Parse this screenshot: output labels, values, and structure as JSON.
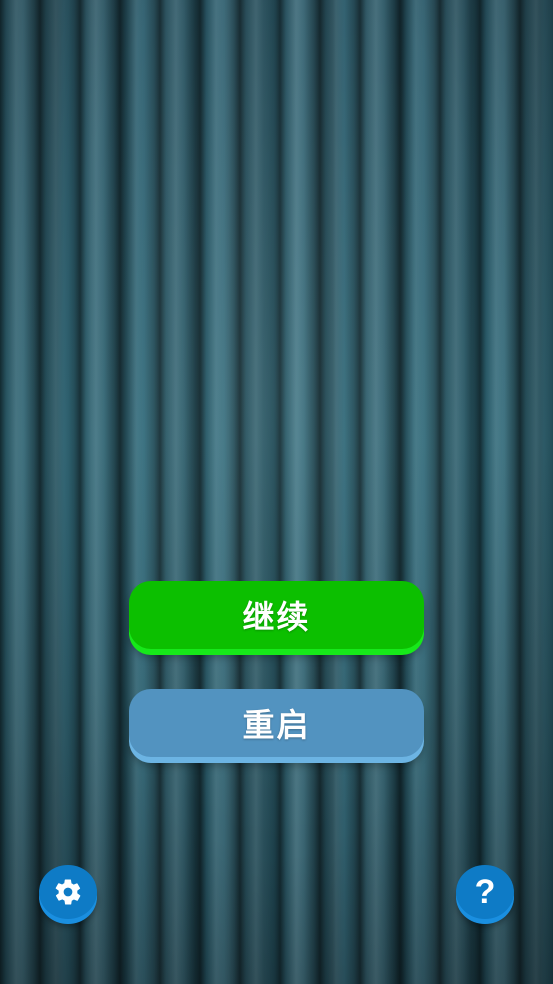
{
  "menu": {
    "continue_label": "继续",
    "restart_label": "重启"
  },
  "corner_buttons": {
    "settings_icon": "gear-icon",
    "help_icon": "question-mark-icon",
    "help_glyph": "?"
  },
  "colors": {
    "background": "#2b5c6c",
    "continue": "#0cbf00",
    "continue_edge": "#17e81a",
    "restart": "#5293c0",
    "restart_edge": "#6cb4e3",
    "round_button": "#0e7bc6"
  }
}
